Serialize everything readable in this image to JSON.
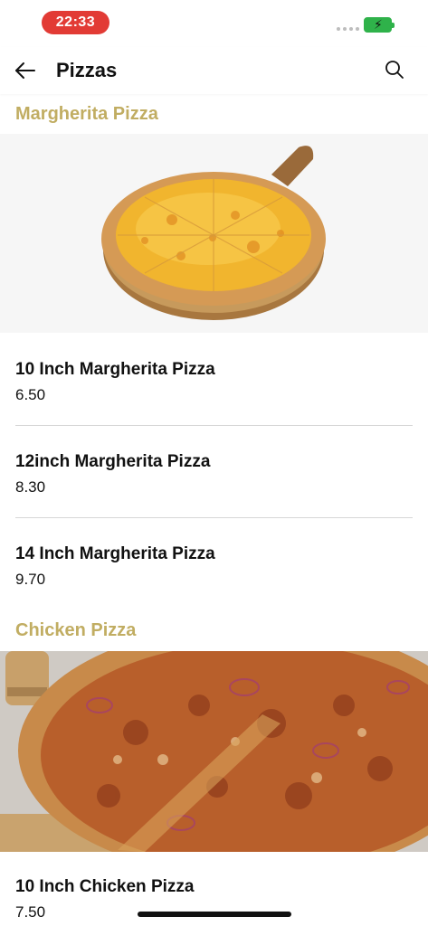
{
  "status_bar": {
    "time": "22:33"
  },
  "header": {
    "title": "Pizzas"
  },
  "categories": [
    {
      "title": "Margherita Pizza",
      "items": [
        {
          "name": "10 Inch Margherita Pizza",
          "price": "6.50"
        },
        {
          "name": "12inch Margherita Pizza",
          "price": "8.30"
        },
        {
          "name": "14 Inch Margherita Pizza",
          "price": "9.70"
        }
      ]
    },
    {
      "title": "Chicken Pizza",
      "items": [
        {
          "name": "10 Inch Chicken Pizza",
          "price": "7.50"
        }
      ]
    }
  ],
  "colors": {
    "accent": "#c1ad62",
    "time_pill": "#e23b35",
    "battery": "#2fb24a"
  },
  "icons": {
    "back": "arrow-left-icon",
    "search": "search-icon"
  }
}
